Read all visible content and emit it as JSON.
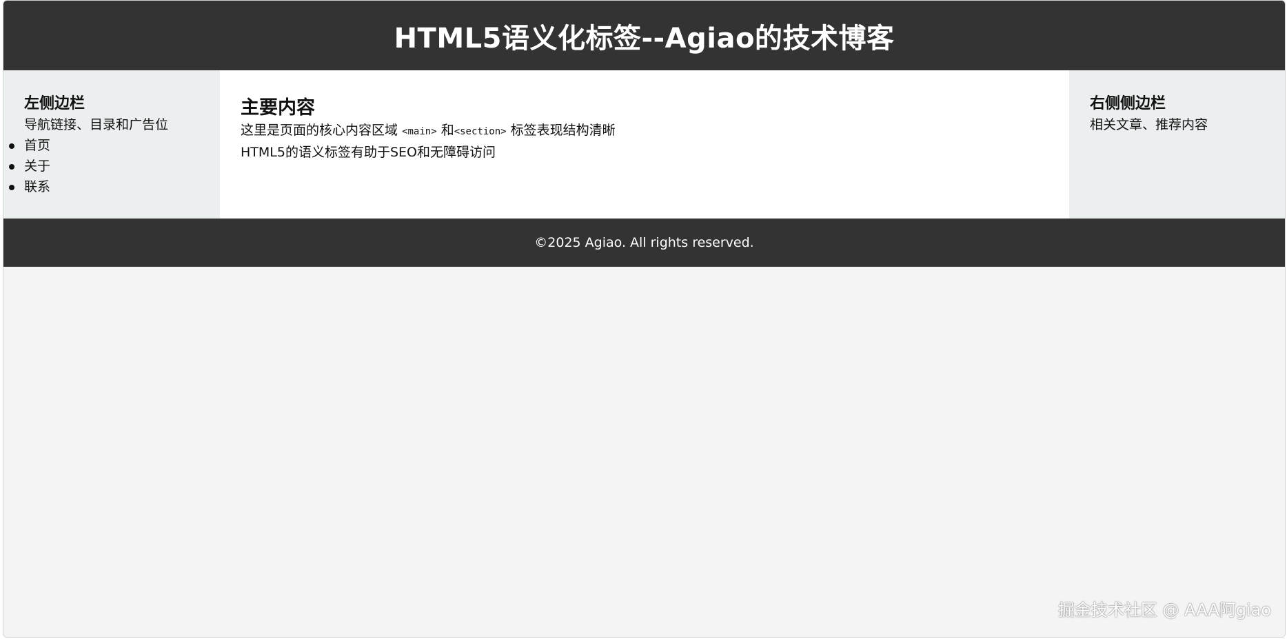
{
  "header": {
    "title": "HTML5语义化标签--Agiao的技术博客"
  },
  "sidebar_left": {
    "heading": "左侧边栏",
    "text": "导航链接、目录和广告位",
    "nav_items": [
      "首页",
      "关于",
      "联系"
    ]
  },
  "main": {
    "heading": "主要内容",
    "line1_prefix": "这里是页面的核心内容区域",
    "code_main": "<main>",
    "and": "和",
    "code_section": "<section>",
    "line1_suffix": "标签表现结构清晰",
    "line2": "HTML5的语义标签有助于SEO和无障碍访问"
  },
  "sidebar_right": {
    "heading": "右侧侧边栏",
    "text": "相关文章、推荐内容"
  },
  "footer": {
    "text": "©2025 Agiao. All rights reserved."
  },
  "watermark": {
    "text": "掘金技术社区 @ AAA阿giao"
  },
  "colors": {
    "header_bg": "#333333",
    "sidebar_bg": "#eceff0",
    "page_bg": "#f4f4f4"
  }
}
